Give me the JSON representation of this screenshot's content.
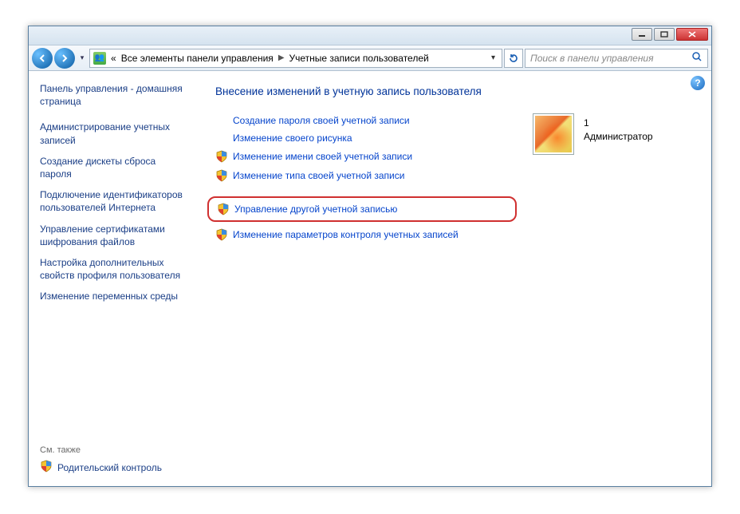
{
  "breadcrumb": {
    "prefix": "«",
    "part1": "Все элементы панели управления",
    "part2": "Учетные записи пользователей"
  },
  "search": {
    "placeholder": "Поиск в панели управления"
  },
  "sidebar": {
    "home_title": "Панель управления - домашняя страница",
    "links": [
      "Администрирование учетных записей",
      "Создание дискеты сброса пароля",
      "Подключение идентификаторов пользователей Интернета",
      "Управление сертификатами шифрования файлов",
      "Настройка дополнительных свойств профиля пользователя",
      "Изменение переменных среды"
    ],
    "see_also": "См. также",
    "parental": "Родительский контроль"
  },
  "main": {
    "heading": "Внесение изменений в учетную запись пользователя",
    "tasks": [
      {
        "label": "Создание пароля своей учетной записи",
        "shield": false
      },
      {
        "label": "Изменение своего рисунка",
        "shield": false
      },
      {
        "label": "Изменение имени своей учетной записи",
        "shield": true
      },
      {
        "label": "Изменение типа своей учетной записи",
        "shield": true
      }
    ],
    "task_highlighted": {
      "label": "Управление другой учетной записью",
      "shield": true
    },
    "task_after": {
      "label": "Изменение параметров контроля учетных записей",
      "shield": true
    },
    "account": {
      "name": "1",
      "role": "Администратор"
    }
  }
}
